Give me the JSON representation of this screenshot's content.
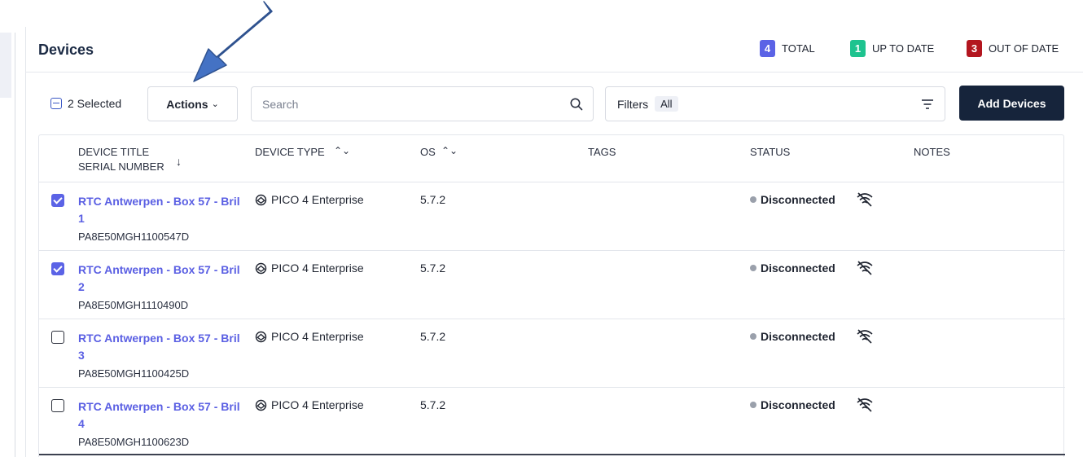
{
  "header": {
    "title": "Devices",
    "stats": [
      {
        "count": "4",
        "label": "TOTAL",
        "color": "#5b63e6"
      },
      {
        "count": "1",
        "label": "UP TO DATE",
        "color": "#1ec38f"
      },
      {
        "count": "3",
        "label": "OUT OF DATE",
        "color": "#b3161f"
      }
    ]
  },
  "toolbar": {
    "selected_text": "2 Selected",
    "actions_label": "Actions",
    "search_placeholder": "Search",
    "filters_label": "Filters",
    "filters_value": "All",
    "add_label": "Add Devices"
  },
  "table": {
    "columns": {
      "title_line1": "DEVICE TITLE",
      "title_line2": "SERIAL NUMBER",
      "device_type": "DEVICE TYPE",
      "os": "OS",
      "tags": "TAGS",
      "status": "STATUS",
      "notes": "NOTES"
    },
    "rows": [
      {
        "checked": true,
        "title": "RTC Antwerpen - Box 57 - Bril 1",
        "serial": "PA8E50MGH1100547D",
        "device_type": "PICO 4 Enterprise",
        "os": "5.7.2",
        "tags": "",
        "status": "Disconnected",
        "notes": ""
      },
      {
        "checked": true,
        "title": "RTC Antwerpen - Box 57 - Bril 2",
        "serial": "PA8E50MGH1110490D",
        "device_type": "PICO 4 Enterprise",
        "os": "5.7.2",
        "tags": "",
        "status": "Disconnected",
        "notes": ""
      },
      {
        "checked": false,
        "title": "RTC Antwerpen - Box 57 - Bril 3",
        "serial": "PA8E50MGH1100425D",
        "device_type": "PICO 4 Enterprise",
        "os": "5.7.2",
        "tags": "",
        "status": "Disconnected",
        "notes": ""
      },
      {
        "checked": false,
        "title": "RTC Antwerpen - Box 57 - Bril 4",
        "serial": "PA8E50MGH1100623D",
        "device_type": "PICO 4 Enterprise",
        "os": "5.7.2",
        "tags": "",
        "status": "Disconnected",
        "notes": ""
      }
    ]
  },
  "annotation": {
    "arrow_color": "#4472c4"
  }
}
